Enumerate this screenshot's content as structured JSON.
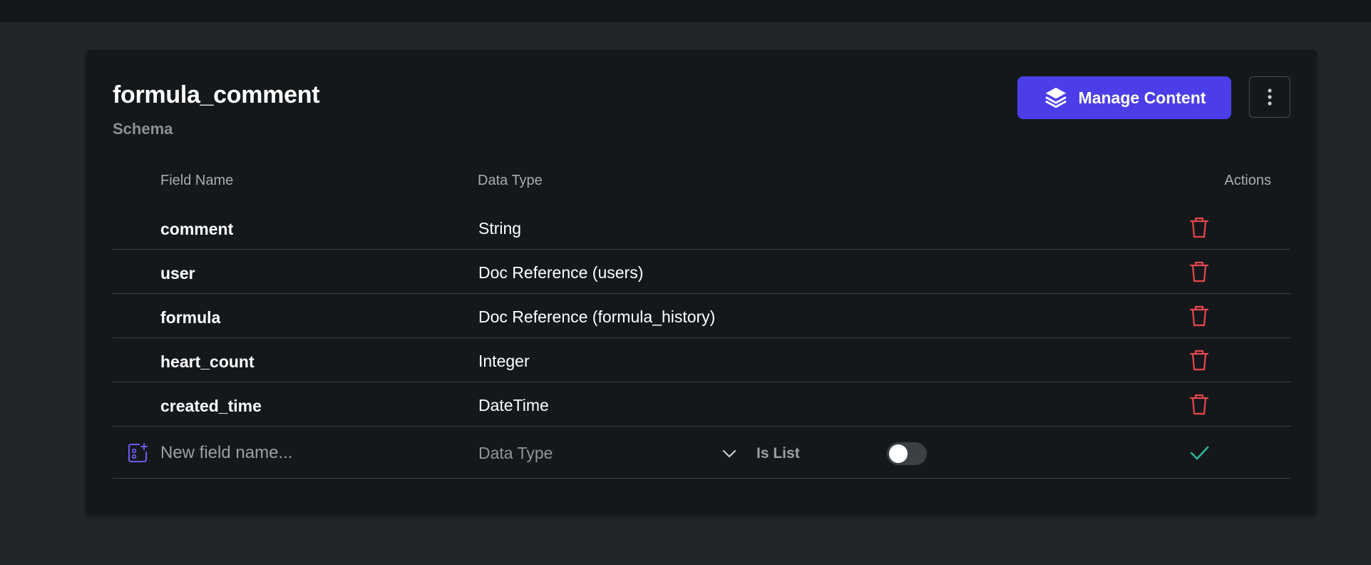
{
  "collection": {
    "title": "formula_comment",
    "subtitle": "Schema"
  },
  "toolbar": {
    "manage_label": "Manage Content"
  },
  "table": {
    "headers": {
      "field_name": "Field Name",
      "data_type": "Data Type",
      "actions": "Actions"
    },
    "rows": [
      {
        "name": "comment",
        "type": "String"
      },
      {
        "name": "user",
        "type": "Doc Reference (users)"
      },
      {
        "name": "formula",
        "type": "Doc Reference (formula_history)"
      },
      {
        "name": "heart_count",
        "type": "Integer"
      },
      {
        "name": "created_time",
        "type": "DateTime"
      }
    ]
  },
  "new_field": {
    "placeholder": "New field name...",
    "data_type_placeholder": "Data Type",
    "is_list_label": "Is List",
    "is_list_on": false
  },
  "colors": {
    "accent": "#4b3ee8",
    "delete": "#e5484d",
    "confirm": "#2fb59a",
    "background": "#21262a",
    "card": "#15181b"
  }
}
